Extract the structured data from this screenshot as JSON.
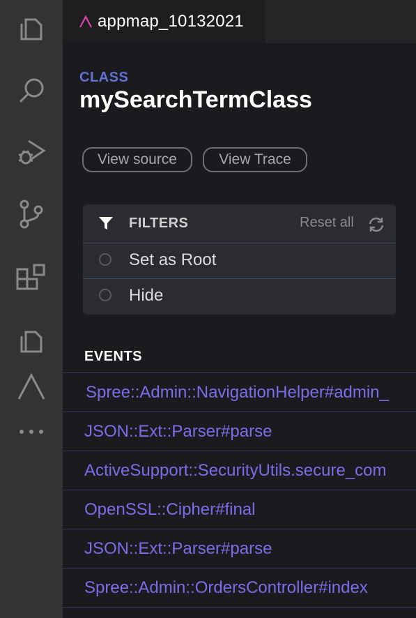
{
  "activity_bar": {
    "items": [
      {
        "icon": "explorer-icon"
      },
      {
        "icon": "search-icon"
      },
      {
        "icon": "run-debug-icon"
      },
      {
        "icon": "source-control-icon"
      },
      {
        "icon": "extensions-icon"
      },
      {
        "icon": "copy-icon"
      },
      {
        "icon": "appmap-icon"
      },
      {
        "icon": "more-icon"
      }
    ]
  },
  "tab": {
    "title": "appmap_10132021",
    "logo_color": "#e040b0"
  },
  "details": {
    "kind": "CLASS",
    "name": "mySearchTermClass",
    "buttons": {
      "view_source": "View source",
      "view_trace": "View Trace"
    }
  },
  "filters": {
    "title": "FILTERS",
    "reset_label": "Reset all",
    "options": [
      {
        "label": "Set as Root"
      },
      {
        "label": "Hide"
      }
    ]
  },
  "events": {
    "title": "EVENTS",
    "items": [
      "Spree::Admin::NavigationHelper#admin_",
      "JSON::Ext::Parser#parse",
      "ActiveSupport::SecurityUtils.secure_com",
      "OpenSSL::Cipher#final",
      "JSON::Ext::Parser#parse",
      "Spree::Admin::OrdersController#index"
    ]
  },
  "colors": {
    "accent": "#5f72d6",
    "event_link": "#7a6ee8",
    "panel_bg": "#1b1b1f",
    "activity_bar_bg": "#333333"
  }
}
